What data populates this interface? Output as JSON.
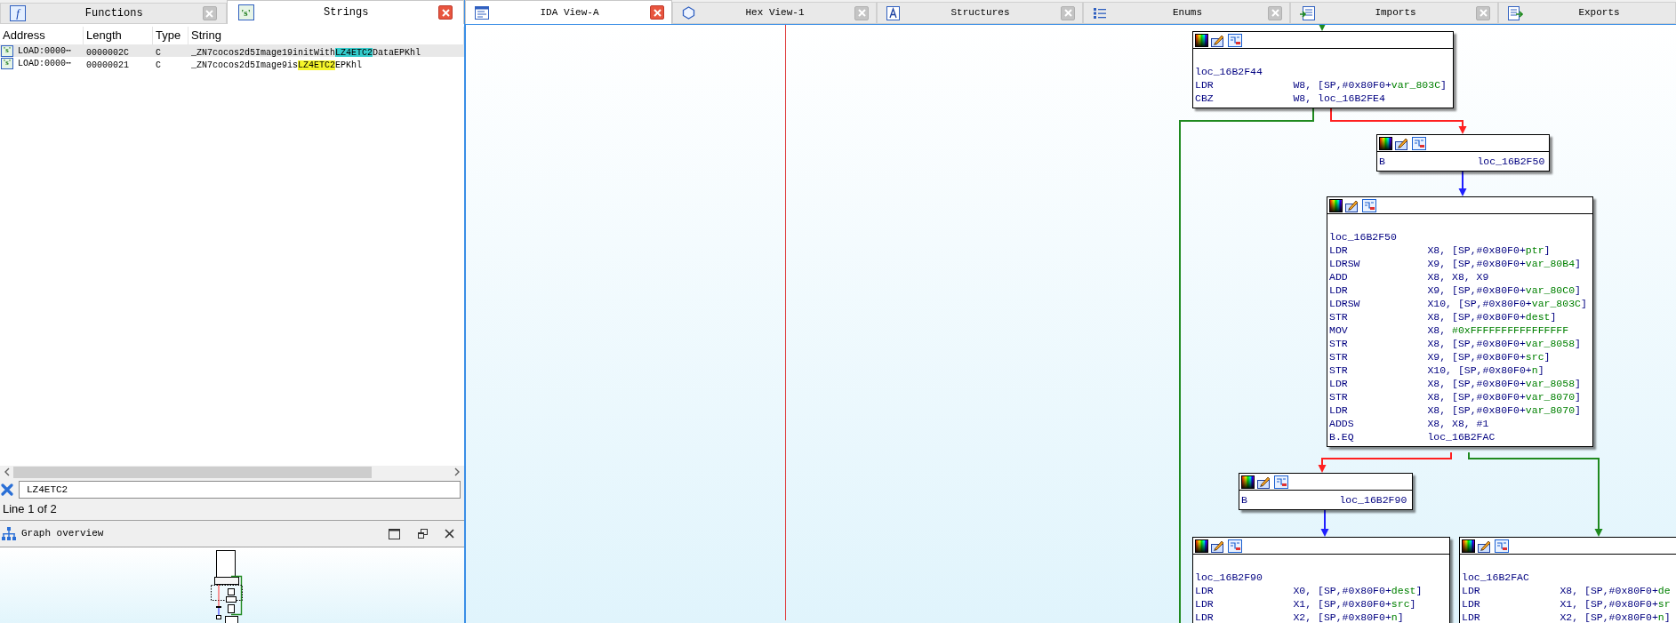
{
  "left_panel": {
    "tabs": [
      {
        "label": "Functions",
        "icon": "f",
        "selected": false
      },
      {
        "label": "Strings",
        "icon": "'s'",
        "selected": true
      }
    ],
    "table": {
      "columns": [
        "Address",
        "Length",
        "Type",
        "String"
      ],
      "rows": [
        {
          "icon": "'s'",
          "selected": true,
          "address": "LOAD:0000⋯",
          "length": "0000002C",
          "type": "C",
          "string": [
            {
              "text": "_ZN7cocos2d5Image19initWith"
            },
            {
              "text": "LZ4ETC2",
              "color": "#33cccc"
            },
            {
              "text": "DataEPKhl"
            }
          ]
        },
        {
          "icon": "'s'",
          "selected": false,
          "address": "LOAD:0000⋯",
          "length": "00000021",
          "type": "C",
          "string": [
            {
              "text": "_ZN7cocos2d5Image9is"
            },
            {
              "text": "LZ4ETC2",
              "color": "#f5f52a"
            },
            {
              "text": "EPKhl"
            }
          ]
        }
      ]
    },
    "filter": {
      "value": "LZ4ETC2"
    },
    "status": "Line 1 of 2",
    "graph_overview": {
      "title": "Graph overview"
    }
  },
  "main_tabs": [
    {
      "label": "IDA View-A",
      "selected": true
    },
    {
      "label": "Hex View-1",
      "selected": false
    },
    {
      "label": "Structures",
      "selected": false
    },
    {
      "label": "Enums",
      "selected": false
    },
    {
      "label": "Imports",
      "selected": false
    },
    {
      "label": "Exports",
      "selected": false
    }
  ],
  "graph": {
    "nodes": [
      {
        "label": "loc_16B2F44",
        "lines": [
          {
            "mnemonic": "LDR",
            "operand": [
              {
                "text": "W8, [SP,#0x80F0+"
              },
              {
                "text": "var_803C",
                "kind": "symbol"
              },
              {
                "text": "]"
              }
            ]
          },
          {
            "mnemonic": "CBZ",
            "operand": [
              {
                "text": "W8, loc_16B2FE4"
              }
            ]
          }
        ]
      },
      {
        "lines": [
          {
            "mnemonic": "B",
            "operand": [
              {
                "text": "loc_16B2F50"
              }
            ]
          }
        ]
      },
      {
        "label": "loc_16B2F50",
        "lines": [
          {
            "mnemonic": "LDR",
            "operand": [
              {
                "text": "X8, [SP,#0x80F0+"
              },
              {
                "text": "ptr",
                "kind": "symbol"
              },
              {
                "text": "]"
              }
            ]
          },
          {
            "mnemonic": "LDRSW",
            "operand": [
              {
                "text": "X9, [SP,#0x80F0+"
              },
              {
                "text": "var_80B4",
                "kind": "symbol"
              },
              {
                "text": "]"
              }
            ]
          },
          {
            "mnemonic": "ADD",
            "operand": [
              {
                "text": "X8, X8, X9"
              }
            ]
          },
          {
            "mnemonic": "LDR",
            "operand": [
              {
                "text": "X9, [SP,#0x80F0+"
              },
              {
                "text": "var_80C0",
                "kind": "symbol"
              },
              {
                "text": "]"
              }
            ]
          },
          {
            "mnemonic": "LDRSW",
            "operand": [
              {
                "text": "X10, [SP,#0x80F0+"
              },
              {
                "text": "var_803C",
                "kind": "symbol"
              },
              {
                "text": "]"
              }
            ]
          },
          {
            "mnemonic": "STR",
            "operand": [
              {
                "text": "X8, [SP,#0x80F0+"
              },
              {
                "text": "dest",
                "kind": "symbol"
              },
              {
                "text": "]"
              }
            ]
          },
          {
            "mnemonic": "MOV",
            "operand": [
              {
                "text": "X8, "
              },
              {
                "text": "#0xFFFFFFFFFFFFFFFF",
                "kind": "symbol"
              }
            ]
          },
          {
            "mnemonic": "STR",
            "operand": [
              {
                "text": "X8, [SP,#0x80F0+"
              },
              {
                "text": "var_8058",
                "kind": "symbol"
              },
              {
                "text": "]"
              }
            ]
          },
          {
            "mnemonic": "STR",
            "operand": [
              {
                "text": "X9, [SP,#0x80F0+"
              },
              {
                "text": "src",
                "kind": "symbol"
              },
              {
                "text": "]"
              }
            ]
          },
          {
            "mnemonic": "STR",
            "operand": [
              {
                "text": "X10, [SP,#0x80F0+"
              },
              {
                "text": "n",
                "kind": "symbol"
              },
              {
                "text": "]"
              }
            ]
          },
          {
            "mnemonic": "LDR",
            "operand": [
              {
                "text": "X8, [SP,#0x80F0+"
              },
              {
                "text": "var_8058",
                "kind": "symbol"
              },
              {
                "text": "]"
              }
            ]
          },
          {
            "mnemonic": "STR",
            "operand": [
              {
                "text": "X8, [SP,#0x80F0+"
              },
              {
                "text": "var_8070",
                "kind": "symbol"
              },
              {
                "text": "]"
              }
            ]
          },
          {
            "mnemonic": "LDR",
            "operand": [
              {
                "text": "X8, [SP,#0x80F0+"
              },
              {
                "text": "var_8070",
                "kind": "symbol"
              },
              {
                "text": "]"
              }
            ]
          },
          {
            "mnemonic": "ADDS",
            "operand": [
              {
                "text": "X8, X8, #1"
              }
            ]
          },
          {
            "mnemonic": "B.EQ",
            "operand": [
              {
                "text": "loc_16B2FAC"
              }
            ]
          }
        ]
      },
      {
        "lines": [
          {
            "mnemonic": "B",
            "operand": [
              {
                "text": "loc_16B2F90"
              }
            ]
          }
        ]
      },
      {
        "label": "loc_16B2F90",
        "lines": [
          {
            "mnemonic": "LDR",
            "operand": [
              {
                "text": "X0, [SP,#0x80F0+"
              },
              {
                "text": "dest",
                "kind": "symbol"
              },
              {
                "text": "]"
              }
            ]
          },
          {
            "mnemonic": "LDR",
            "operand": [
              {
                "text": "X1, [SP,#0x80F0+"
              },
              {
                "text": "src",
                "kind": "symbol"
              },
              {
                "text": "]"
              }
            ]
          },
          {
            "mnemonic": "LDR",
            "operand": [
              {
                "text": "X2, [SP,#0x80F0+"
              },
              {
                "text": "n",
                "kind": "symbol"
              },
              {
                "text": "]"
              }
            ]
          }
        ]
      },
      {
        "label": "loc_16B2FAC",
        "lines": [
          {
            "mnemonic": "LDR",
            "operand": [
              {
                "text": "X8, [SP,#0x80F0+"
              },
              {
                "text": "de",
                "kind": "symbol"
              }
            ]
          },
          {
            "mnemonic": "LDR",
            "operand": [
              {
                "text": "X1, [SP,#0x80F0+"
              },
              {
                "text": "sr",
                "kind": "symbol"
              }
            ]
          },
          {
            "mnemonic": "LDR",
            "operand": [
              {
                "text": "X2, [SP,#0x80F0+"
              },
              {
                "text": "n",
                "kind": "symbol"
              },
              {
                "text": "]"
              }
            ]
          }
        ]
      }
    ],
    "edges": [
      {
        "color": "#1f8a1f"
      },
      {
        "color": "#1f8a1f"
      },
      {
        "color": "#ff2020"
      },
      {
        "color": "#2020ff"
      },
      {
        "color": "#ff2020"
      },
      {
        "color": "#1f8a1f"
      },
      {
        "color": "#2020ff"
      }
    ]
  }
}
